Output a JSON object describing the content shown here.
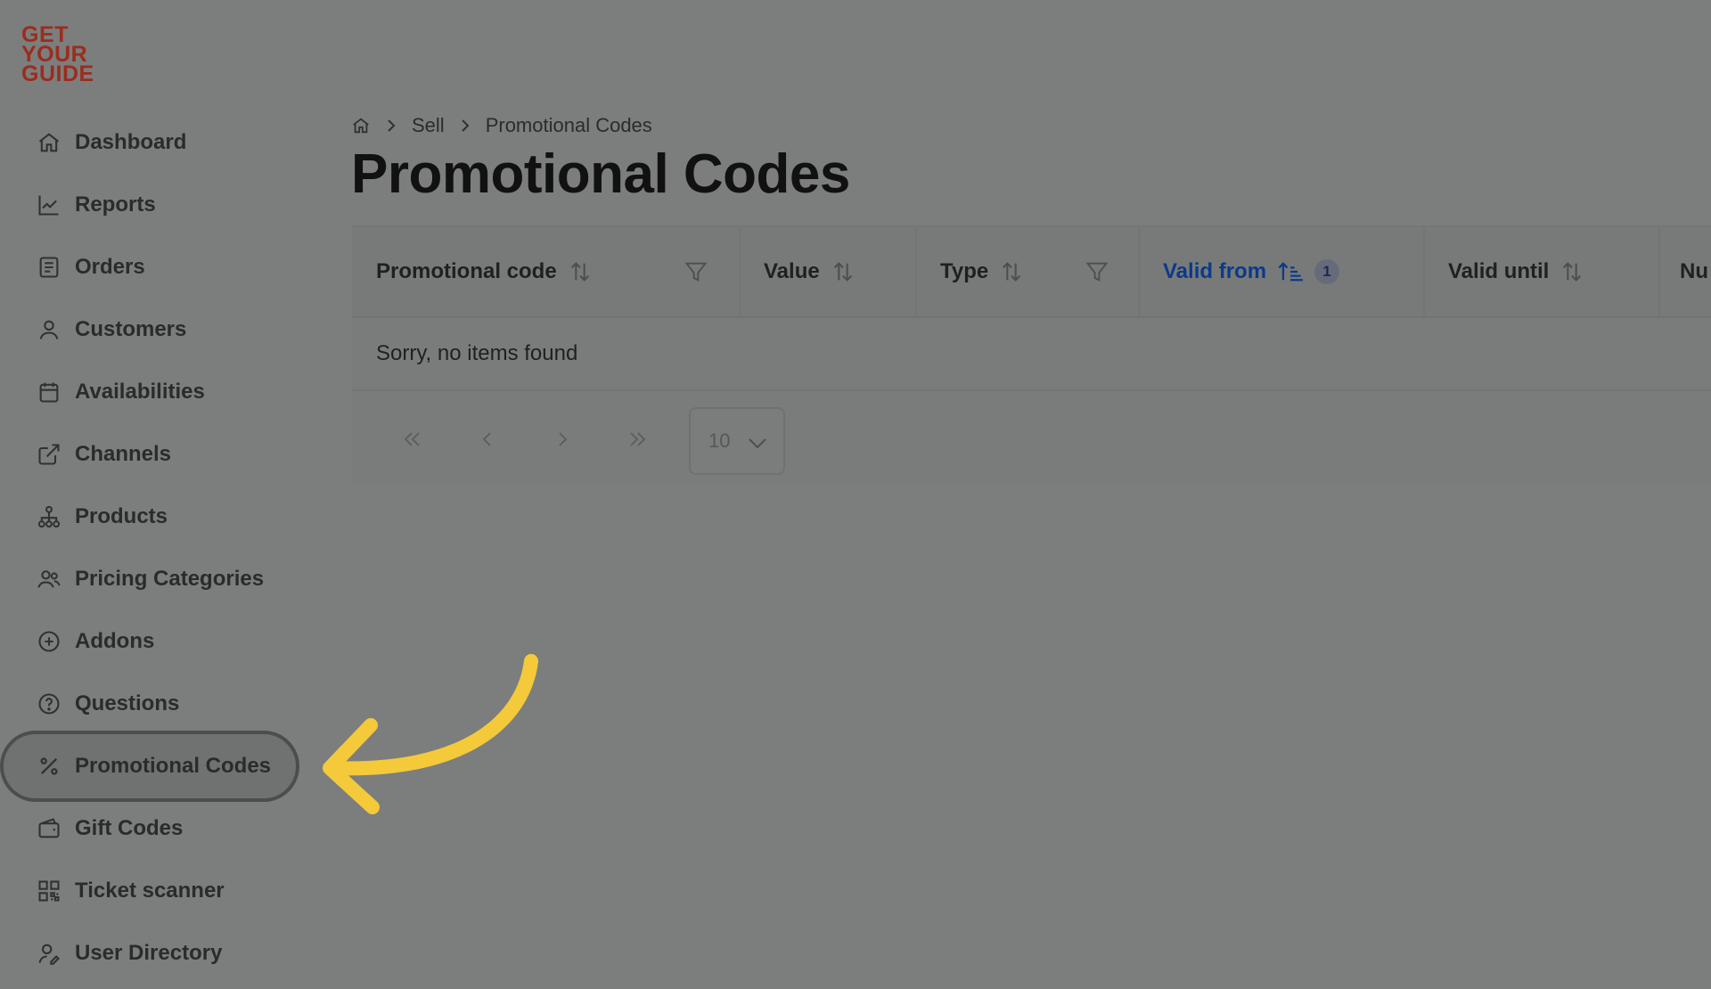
{
  "logo": {
    "line1": "GET",
    "line2": "YOUR",
    "line3": "GUIDE",
    "color": "#9a2d1f"
  },
  "sidebar": {
    "items": [
      {
        "label": "Dashboard",
        "icon": "home-icon"
      },
      {
        "label": "Reports",
        "icon": "chart-line-icon"
      },
      {
        "label": "Orders",
        "icon": "receipt-icon"
      },
      {
        "label": "Customers",
        "icon": "user-icon"
      },
      {
        "label": "Availabilities",
        "icon": "calendar-icon"
      },
      {
        "label": "Channels",
        "icon": "external-link-icon"
      },
      {
        "label": "Products",
        "icon": "hierarchy-icon"
      },
      {
        "label": "Pricing Categories",
        "icon": "users-icon"
      },
      {
        "label": "Addons",
        "icon": "plus-circle-icon"
      },
      {
        "label": "Questions",
        "icon": "help-circle-icon"
      },
      {
        "label": "Promotional Codes",
        "icon": "percent-icon",
        "active": true
      },
      {
        "label": "Gift Codes",
        "icon": "wallet-icon"
      },
      {
        "label": "Ticket scanner",
        "icon": "qr-code-icon"
      },
      {
        "label": "User Directory",
        "icon": "user-edit-icon"
      }
    ]
  },
  "breadcrumb": {
    "home_icon": "home-icon",
    "items": [
      "Sell",
      "Promotional Codes"
    ]
  },
  "page": {
    "title": "Promotional Codes"
  },
  "table": {
    "columns": [
      {
        "label": "Promotional code",
        "sortable": true,
        "filterable": true
      },
      {
        "label": "Value",
        "sortable": true,
        "filterable": false
      },
      {
        "label": "Type",
        "sortable": true,
        "filterable": true
      },
      {
        "label": "Valid from",
        "sortable": true,
        "sorted": "ascending",
        "badge": "1"
      },
      {
        "label": "Valid until",
        "sortable": true
      },
      {
        "label": "Nu"
      }
    ],
    "empty_message": "Sorry, no items found"
  },
  "pagination": {
    "first_icon": "double-chevron-left-icon",
    "prev_icon": "chevron-left-icon",
    "next_icon": "chevron-right-icon",
    "last_icon": "double-chevron-right-icon",
    "page_size": "10"
  },
  "colors": {
    "active_sort": "#0c3a8a",
    "highlight_arrow": "#f4c93a"
  }
}
